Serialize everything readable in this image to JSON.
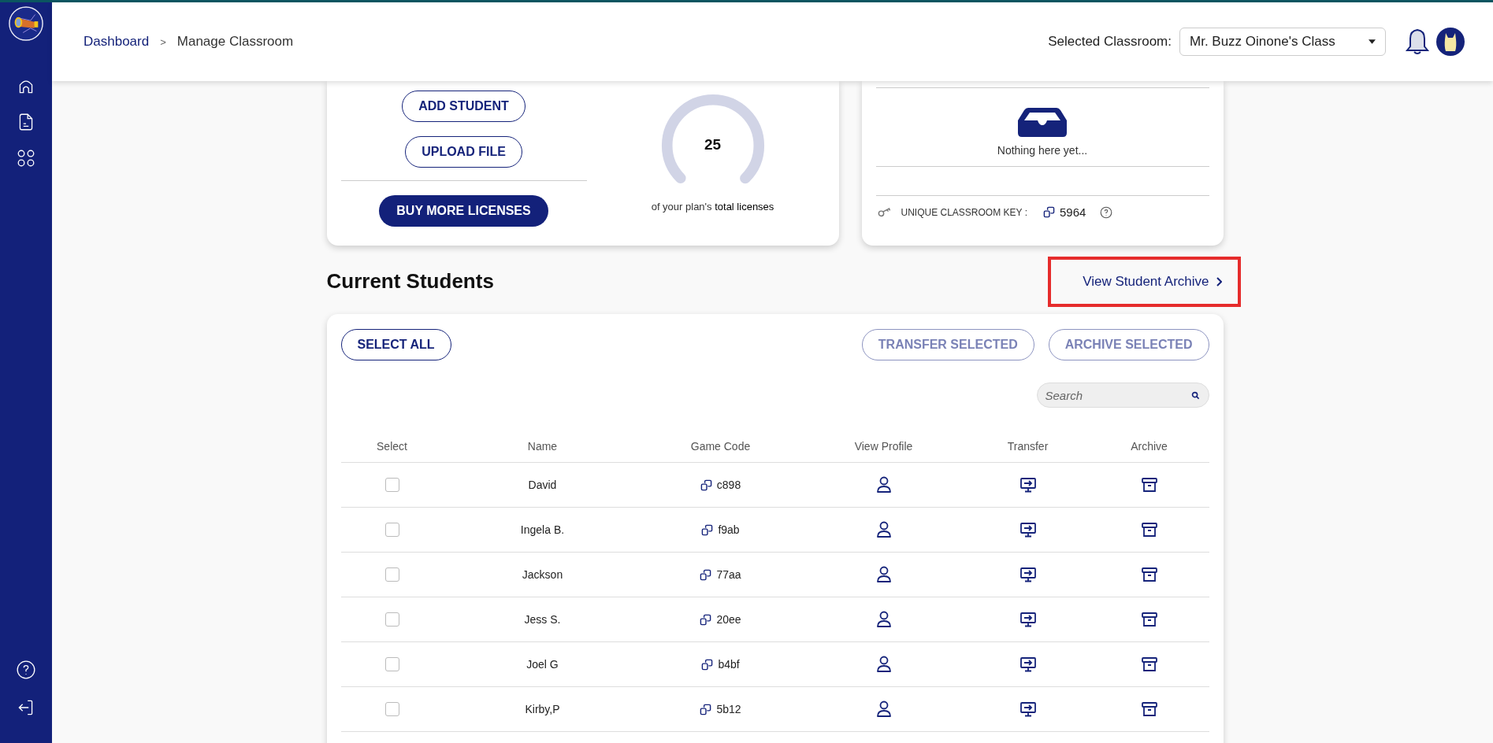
{
  "breadcrumb": {
    "items": [
      "Dashboard",
      "Manage Classroom"
    ],
    "separator": ">"
  },
  "classroom_select": {
    "label": "Selected Classroom:",
    "value": "Mr. Buzz Oinone's Class"
  },
  "roster_card": {
    "buttons": [
      {
        "label": "ADD STUDENT",
        "kind": "outline"
      },
      {
        "label": "UPLOAD FILE",
        "kind": "outline"
      },
      {
        "label": "BUY MORE LICENSES",
        "kind": "filled"
      }
    ]
  },
  "license_gauge": {
    "value": "25",
    "caption": "of your plan's **total licenses**"
  },
  "archive_card": {
    "empty_text": "Nothing here yet...",
    "key_label": "UNIQUE CLASSROOM KEY :",
    "key": "5964"
  },
  "section": {
    "title": "Current Students",
    "link": "View Student Archive",
    "link_highlighted": true
  },
  "students_toolbar": {
    "buttons": [
      {
        "label": "SELECT ALL",
        "disabled": false
      },
      {
        "label": "TRANSFER SELECTED",
        "disabled": true
      },
      {
        "label": "ARCHIVE SELECTED",
        "disabled": true
      }
    ],
    "search": {
      "placeholder": "Search"
    }
  },
  "table": {
    "columns": [
      "Select",
      "Name",
      "Game Code",
      "View Profile",
      "Transfer",
      "Archive"
    ],
    "rows": [
      {
        "checked": false,
        "name": "David",
        "game_code": "c898"
      },
      {
        "checked": false,
        "name": "Ingela B.",
        "game_code": "f9ab"
      },
      {
        "checked": false,
        "name": "Jackson",
        "game_code": "77aa"
      },
      {
        "checked": false,
        "name": "Jess S.",
        "game_code": "20ee"
      },
      {
        "checked": false,
        "name": "Joel G",
        "game_code": "b4bf"
      },
      {
        "checked": false,
        "name": "Kirby,P",
        "game_code": "5b12"
      }
    ]
  }
}
